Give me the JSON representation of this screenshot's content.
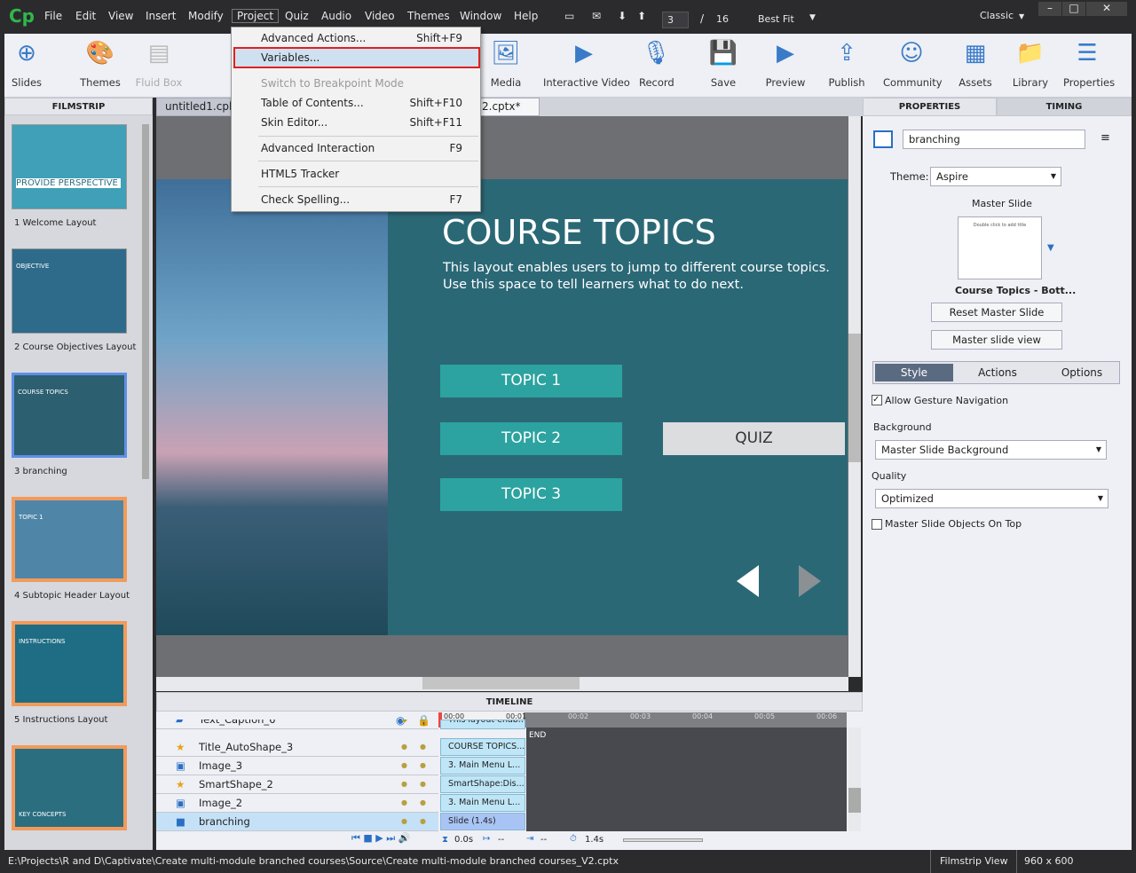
{
  "app": {
    "logo": "Cp",
    "mode": "Classic"
  },
  "menubar": [
    "File",
    "Edit",
    "View",
    "Insert",
    "Modify",
    "Project",
    "Quiz",
    "Audio",
    "Video",
    "Themes",
    "Window",
    "Help"
  ],
  "nav": {
    "current_slide": "3",
    "separator": "/",
    "total_slides": "16",
    "zoom": "Best Fit"
  },
  "toolbar": [
    {
      "label": "Slides",
      "icon": "plus-circle-icon"
    },
    {
      "label": "Themes",
      "icon": "palette-icon"
    },
    {
      "label": "Fluid Box",
      "icon": "fluid-box-icon",
      "disabled": true
    },
    {
      "label": "Media",
      "icon": "image-icon"
    },
    {
      "label": "Interactive Video",
      "icon": "interactive-video-icon"
    },
    {
      "label": "Record",
      "icon": "microphone-icon"
    },
    {
      "label": "Save",
      "icon": "save-icon"
    },
    {
      "label": "Preview",
      "icon": "play-icon"
    },
    {
      "label": "Publish",
      "icon": "publish-icon"
    },
    {
      "label": "Community",
      "icon": "community-icon"
    },
    {
      "label": "Assets",
      "icon": "assets-icon"
    },
    {
      "label": "Library",
      "icon": "library-icon"
    },
    {
      "label": "Properties",
      "icon": "properties-icon"
    }
  ],
  "project_menu": [
    {
      "label": "Advanced Actions...",
      "shortcut": "Shift+F9"
    },
    {
      "label": "Variables...",
      "shortcut": "",
      "highlighted": true
    },
    {
      "label": "Switch to Breakpoint Mode",
      "shortcut": "",
      "disabled": true
    },
    {
      "label": "Table of Contents...",
      "shortcut": "Shift+F10"
    },
    {
      "label": "Skin Editor...",
      "shortcut": "Shift+F11"
    },
    {
      "label": "Advanced Interaction",
      "shortcut": "F9"
    },
    {
      "label": "HTML5 Tracker",
      "shortcut": ""
    },
    {
      "label": "Check Spelling...",
      "shortcut": "F7"
    }
  ],
  "filmstrip": {
    "title": "FILMSTRIP",
    "slides": [
      {
        "label": "1 Welcome Layout",
        "thumb_text": "PROVIDE PERSPECTIVE"
      },
      {
        "label": "2 Course Objectives Layout",
        "thumb_text": "OBJECTIVE"
      },
      {
        "label": "3 branching",
        "thumb_text": "COURSE TOPICS",
        "selected": true
      },
      {
        "label": "4 Subtopic Header Layout",
        "thumb_text": "TOPIC 1"
      },
      {
        "label": "5 Instructions Layout",
        "thumb_text": "INSTRUCTIONS"
      },
      {
        "label": "",
        "thumb_text": "KEY CONCEPTS"
      }
    ]
  },
  "tabs": [
    {
      "label": "untitled1.cpbx"
    },
    {
      "label": "2.cptx*",
      "close": "×"
    }
  ],
  "slide": {
    "title": "COURSE TOPICS",
    "body": "This layout enables users to jump to different course topics. Use this space to tell learners what to do next.",
    "buttons": [
      "TOPIC 1",
      "TOPIC 2",
      "TOPIC 3",
      "QUIZ"
    ]
  },
  "properties": {
    "tab_properties": "PROPERTIES",
    "tab_timing": "TIMING",
    "name": "branching",
    "theme_label": "Theme:",
    "theme": "Aspire",
    "master_slide_label": "Master Slide",
    "master_thumb_text": "Double click to add title",
    "master_name": "Course Topics - Bott...",
    "reset_master": "Reset Master Slide",
    "master_view": "Master slide view",
    "subtabs": [
      "Style",
      "Actions",
      "Options"
    ],
    "allow_gesture": "Allow Gesture Navigation",
    "allow_gesture_checked": true,
    "background_label": "Background",
    "background": "Master Slide Background",
    "quality_label": "Quality",
    "quality": "Optimized",
    "master_on_top": "Master Slide Objects On Top",
    "master_on_top_checked": false
  },
  "timeline": {
    "title": "TIMELINE",
    "ticks": [
      "00:00",
      "00:01",
      "00:02",
      "00:03",
      "00:04",
      "00:05",
      "00:06"
    ],
    "end": "END",
    "rows": [
      {
        "name": "Text_Caption_6",
        "bar": "This layout enab...",
        "icon": "caption-icon"
      },
      {
        "name": "Title_AutoShape_3",
        "bar": "COURSE TOPICS...",
        "icon": "star-icon"
      },
      {
        "name": "Image_3",
        "bar": "3. Main Menu L...",
        "icon": "image-icon"
      },
      {
        "name": "SmartShape_2",
        "bar": "SmartShape:Dis...",
        "icon": "star-icon"
      },
      {
        "name": "Image_2",
        "bar": "3. Main Menu L...",
        "icon": "image-icon"
      },
      {
        "name": "branching",
        "bar": "Slide (1.4s)",
        "icon": "slide-icon",
        "selected": true
      }
    ],
    "start": "0.0s",
    "in": "--",
    "out": "--",
    "duration": "1.4s"
  },
  "status": {
    "path": "E:\\Projects\\R and D\\Captivate\\Create multi-module branched courses\\Source\\Create multi-module branched courses_V2.cptx",
    "view": "Filmstrip View",
    "size": "960 x 600"
  },
  "colors": {
    "accent": "#2ca3a0",
    "slide_bg": "#2b6876",
    "highlight_border": "#e02020"
  }
}
